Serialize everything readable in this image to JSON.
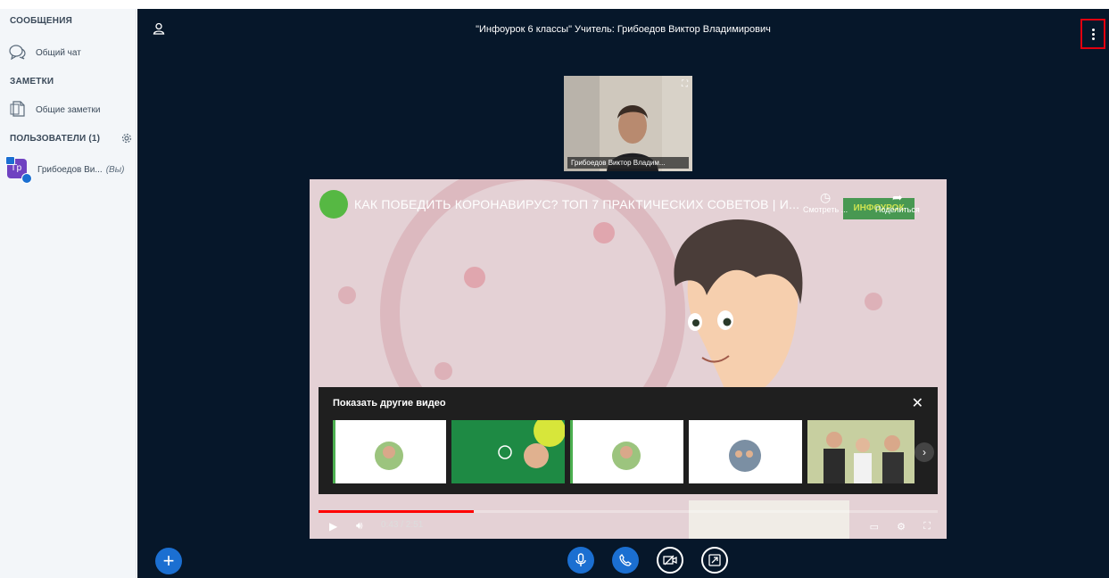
{
  "sidebar": {
    "messages_header": "СООБЩЕНИЯ",
    "public_chat": "Общий чат",
    "notes_header": "ЗАМЕТКИ",
    "shared_notes": "Общие заметки",
    "users_header": "ПОЛЬЗОВАТЕЛИ (1)",
    "user": {
      "initials": "Гр",
      "name": "Грибоедов Ви...",
      "you_tag": "(Вы)"
    }
  },
  "meeting": {
    "title": "\"Инфоурок 6 классы\" Учитель: Грибоедов Виктор Владимирович"
  },
  "webcam": {
    "name": "Грибоедов Виктор Владим..."
  },
  "video": {
    "title": "КАК ПОБЕДИТЬ КОРОНАВИРУС? ТОП 7 ПРАКТИЧЕСКИХ СОВЕТОВ | И...",
    "watch_later": "Смотреть ...",
    "share": "Поделиться",
    "logo_text": "ИНФОУРОК",
    "more_videos_title": "Показать другие видео",
    "time": "0:43 / 2:51",
    "progress_fraction": 0.251
  },
  "colors": {
    "background": "#06172a",
    "accent": "#1b6fd1",
    "highlight_box": "#e3000f"
  }
}
